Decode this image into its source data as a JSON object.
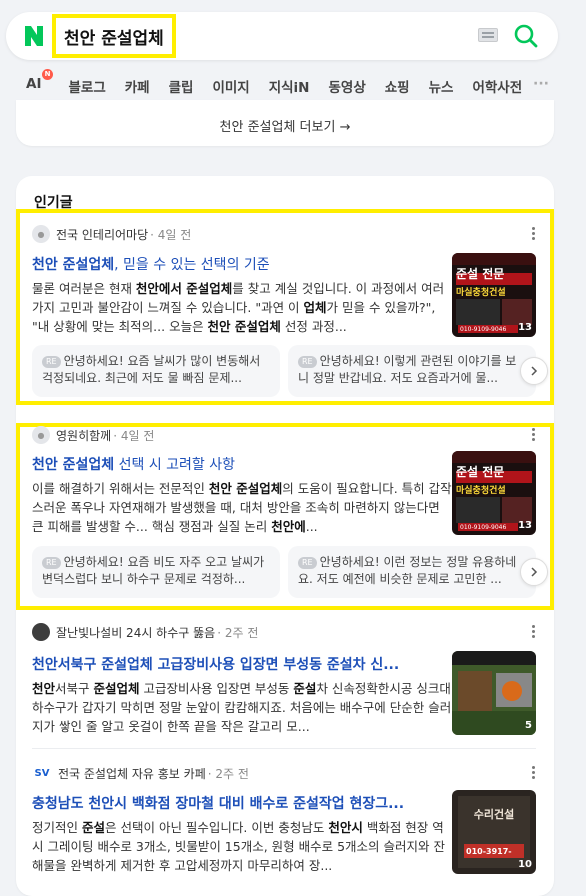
{
  "search": {
    "query": "천안 준설업체"
  },
  "tabs": [
    "AI",
    "블로그",
    "카페",
    "클립",
    "이미지",
    "지식iN",
    "동영상",
    "쇼핑",
    "뉴스",
    "어학사전"
  ],
  "tab_ai_badge": "N",
  "more_link": "천안 준설업체 더보기 →",
  "section_title": "인기글",
  "posts": [
    {
      "author": "전국 인테리어마당",
      "time": "· 4일 전",
      "title": "천안 준설업체",
      "title_rest": ", 믿을 수 있는 선택의 기준",
      "body_html": "물론 여러분은 현재 <b>천안에서 준설업체</b>를 찾고 계실 것입니다. 이 과정에서 여러 가지 고민과 불안감이 느껴질 수 있습니다. \"과연 이 <b>업체</b>가 믿을 수 있을까?\", \"내 상황에 맞는 최적의... 오늘은 <b>천안 준설업체</b> 선정 과정...",
      "thumb_count": "13",
      "replies": [
        "안녕하세요! 요즘 날씨가 많이 변동해서 걱정되네요. 최근에 저도 물 빠짐 문제...",
        "안녕하세요! 이렇게 관련된 이야기를 보니 정말 반갑네요. 저도 요즘과거에 물..."
      ]
    },
    {
      "author": "영원히함께",
      "time": "· 4일 전",
      "title": "천안 준설업체",
      "title_rest": " 선택 시 고려할 사항",
      "body_html": "이를 해결하기 위해서는 전문적인 <b>천안 준설업체</b>의 도움이 필요합니다. 특히 갑작스러운 폭우나 자연재해가 발생했을 때, 대처 방안을 조속히 마련하지 않는다면 큰 피해를 발생할 수... 핵심 쟁점과 실질 논리 <b>천안에</b>...",
      "thumb_count": "13",
      "replies": [
        "안녕하세요! 요즘 비도 자주 오고 날씨가 변덕스럽다 보니 하수구 문제로 걱정하...",
        "안녕하세요! 이런 정보는 정말 유용하네요. 저도 예전에 비슷한 문제로 고민한 ..."
      ]
    },
    {
      "author": "잘난빛나설비 24시 하수구 뚫음",
      "time": "· 2주 전",
      "title": "천안서북구 준설업체 고급장비사용 입장면 부성동 준설차 신...",
      "body_html": "<b>천안</b>서북구 <b>준설업체</b> 고급장비사용 입장면 부성동 <b>준설</b>차 신속정확한시공 싱크대 하수구가 갑자기 막히면 정말 눈앞이 캄캄해지죠. 처음에는 배수구에 단순한 슬러지가 쌓인 줄 알고 옷걸이 한쪽 끝을 작은 갈고리 모...",
      "thumb_count": "5"
    },
    {
      "author": "전국 준설업체 자유 홍보 카페",
      "time": "· 2주 전",
      "title": "충청남도 천안시 백화점 장마철 대비 배수로 준설작업 현장그...",
      "body_html": "정기적인 <b>준설</b>은 선택이 아닌 필수입니다. 이번 충청남도 <b>천안시</b> 백화점 현장 역시 그레이팅 배수로 3개소, 빗물받이 15개소, 원형 배수로 5개소의 슬러지와 잔해물을 완벽하게 제거한 후 고압세정까지 마무리하여 장...",
      "thumb_count": "10"
    }
  ],
  "thumb_texts": {
    "promo_title": "준설 전문",
    "promo_sub": "마실충청건설",
    "promo_phone": "010-9109-9046",
    "suri": "수리건설",
    "suri_phone": "010-3917-"
  },
  "avatar_sv": "SV"
}
